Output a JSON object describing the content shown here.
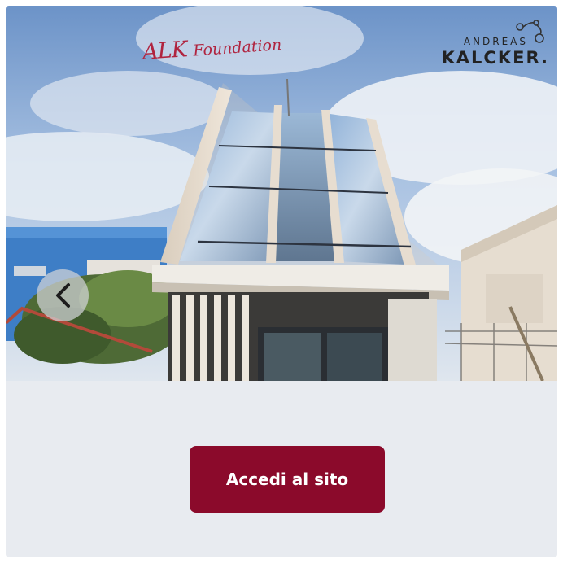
{
  "hero": {
    "signature_main": "ALK",
    "signature_tail": "Foundation",
    "brand_top": "ANDREAS",
    "brand_main": "KALCKER."
  },
  "cta": {
    "label": "Accedi al sito"
  },
  "colors": {
    "accent": "#8b0a2b",
    "signature": "#b0243f",
    "panel": "#e8ebf0"
  },
  "icons": {
    "prev": "chevron-left-icon",
    "logo": "alk-molecule-icon"
  }
}
